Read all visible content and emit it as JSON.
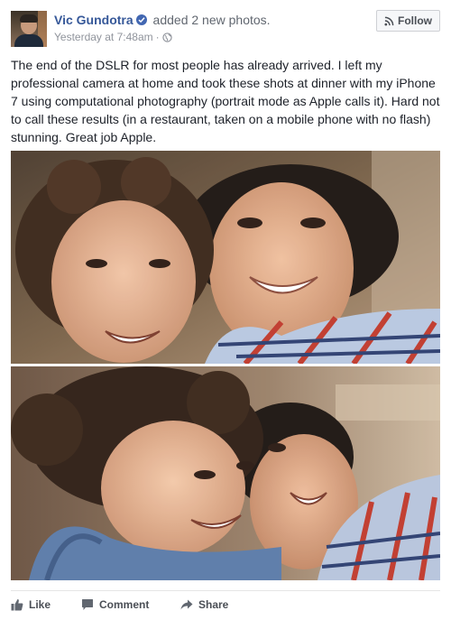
{
  "post": {
    "author_name": "Vic Gundotra",
    "action": "added 2 new photos.",
    "timestamp": "Yesterday at 7:48am",
    "separator": "·",
    "follow_label": "Follow",
    "text": "The end of the DSLR for most people has already arrived. I left my professional camera at home and took these shots at dinner with my iPhone 7 using computational photography (portrait mode as Apple calls it). Hard not to call these results (in a restaurant, taken on a mobile phone with no flash) stunning. Great job Apple.",
    "icons": {
      "verified": "verified-badge-icon",
      "privacy": "globe-icon",
      "follow": "rss-icon"
    }
  },
  "actions": {
    "like_label": "Like",
    "comment_label": "Comment",
    "share_label": "Share",
    "icons": [
      "thumbs-up-icon",
      "comment-bubble-icon",
      "share-arrow-icon"
    ]
  },
  "colors": {
    "link_blue": "#365899",
    "verified_blue": "#4267b2",
    "meta_gray": "#90949c",
    "text_dark": "#1d2129"
  }
}
